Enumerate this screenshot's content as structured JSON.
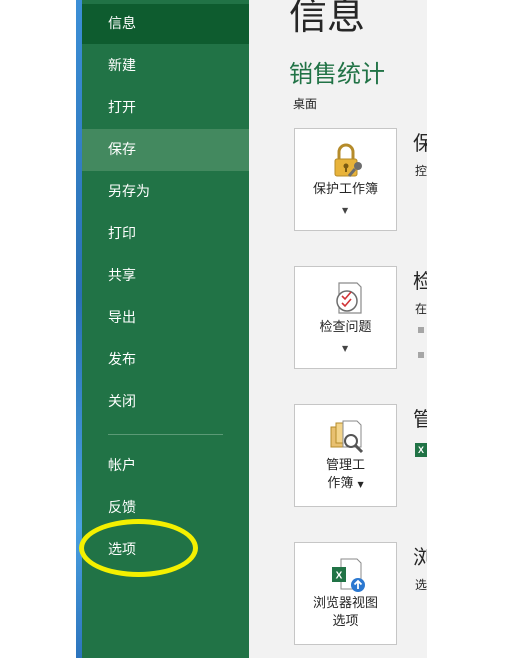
{
  "sidebar": {
    "items": [
      {
        "label": "信息"
      },
      {
        "label": "新建"
      },
      {
        "label": "打开"
      },
      {
        "label": "保存"
      },
      {
        "label": "另存为"
      },
      {
        "label": "打印"
      },
      {
        "label": "共享"
      },
      {
        "label": "导出"
      },
      {
        "label": "发布"
      },
      {
        "label": "关闭"
      },
      {
        "label": "帐户"
      },
      {
        "label": "反馈"
      },
      {
        "label": "选项"
      }
    ],
    "active_item": "信息",
    "hover_item": "保存"
  },
  "main": {
    "page_title": "信息",
    "doc_title": "销售统计",
    "doc_location": "桌面",
    "sections": [
      {
        "tile_label": "保护工作簿",
        "heading": "保",
        "sub": "控"
      },
      {
        "tile_label": "检查问题",
        "heading": "检",
        "sub": "在"
      },
      {
        "tile_label_line1": "管理工",
        "tile_label_line2": "作簿",
        "heading": "管",
        "sub": "X"
      },
      {
        "tile_label_line1": "浏览器视图",
        "tile_label_line2": "选项",
        "heading": "浏",
        "sub": "选"
      }
    ]
  },
  "colors": {
    "sidebar_bg": "#217346",
    "active_bg": "#0e5c2f",
    "hover_bg": "#43895f",
    "accent_title": "#217346",
    "annotation": "#f4f000"
  }
}
